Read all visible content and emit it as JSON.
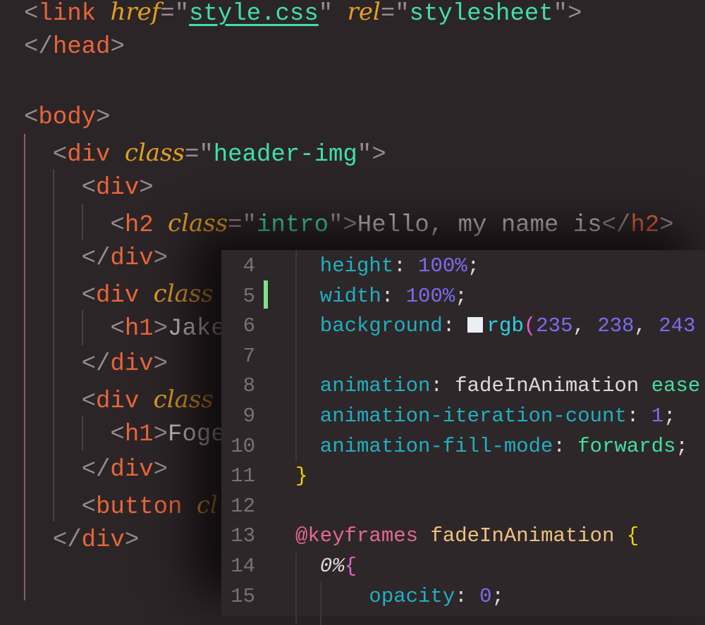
{
  "html_editor": {
    "lines": [
      [
        [
          "<",
          "br"
        ],
        [
          "link",
          "tag"
        ],
        [
          " ",
          ""
        ],
        [
          "href",
          "attr"
        ],
        [
          "=\"",
          "br"
        ],
        [
          "style.css",
          "str ul"
        ],
        [
          "\"",
          "br"
        ],
        [
          " ",
          ""
        ],
        [
          "rel",
          "attr"
        ],
        [
          "=\"",
          "br"
        ],
        [
          "stylesheet",
          "str"
        ],
        [
          "\">",
          "br"
        ]
      ],
      [
        [
          "</",
          "br"
        ],
        [
          "head",
          "tag"
        ],
        [
          ">",
          "br"
        ]
      ],
      [],
      [
        [
          "<",
          "br"
        ],
        [
          "body",
          "tag"
        ],
        [
          ">",
          "br"
        ]
      ],
      [
        [
          "  <",
          "br"
        ],
        [
          "div",
          "tag"
        ],
        [
          " ",
          ""
        ],
        [
          "class",
          "attr"
        ],
        [
          "=\"",
          "br"
        ],
        [
          "header-img",
          "str"
        ],
        [
          "\">",
          "br"
        ]
      ],
      [
        [
          "    <",
          "br"
        ],
        [
          "div",
          "tag"
        ],
        [
          ">",
          "br"
        ]
      ],
      [
        [
          "      <",
          "br"
        ],
        [
          "h2",
          "tag"
        ],
        [
          " ",
          ""
        ],
        [
          "class",
          "attr"
        ],
        [
          "=\"",
          "br"
        ],
        [
          "intro",
          "str"
        ],
        [
          "\">",
          "br"
        ],
        [
          "Hello, my name is",
          "txt"
        ],
        [
          "</",
          "br"
        ],
        [
          "h2",
          "tag"
        ],
        [
          ">",
          "br"
        ]
      ],
      [
        [
          "    </",
          "br"
        ],
        [
          "div",
          "tag"
        ],
        [
          ">",
          "br"
        ]
      ],
      [
        [
          "    <",
          "br"
        ],
        [
          "div",
          "tag"
        ],
        [
          " ",
          ""
        ],
        [
          "class",
          "attr"
        ]
      ],
      [
        [
          "      <",
          "br"
        ],
        [
          "h1",
          "tag"
        ],
        [
          ">",
          "br"
        ],
        [
          "Jake",
          "txt"
        ]
      ],
      [
        [
          "    </",
          "br"
        ],
        [
          "div",
          "tag"
        ],
        [
          ">",
          "br"
        ]
      ],
      [
        [
          "    <",
          "br"
        ],
        [
          "div",
          "tag"
        ],
        [
          " ",
          ""
        ],
        [
          "class",
          "attr"
        ]
      ],
      [
        [
          "      <",
          "br"
        ],
        [
          "h1",
          "tag"
        ],
        [
          ">",
          "br"
        ],
        [
          "Foge",
          "txt"
        ]
      ],
      [
        [
          "    </",
          "br"
        ],
        [
          "div",
          "tag"
        ],
        [
          ">",
          "br"
        ]
      ],
      [
        [
          "    <",
          "br"
        ],
        [
          "button",
          "tag"
        ],
        [
          " ",
          ""
        ],
        [
          "cl",
          "attr"
        ]
      ],
      [
        [
          "  </",
          "br"
        ],
        [
          "div",
          "tag"
        ],
        [
          ">",
          "br"
        ]
      ]
    ]
  },
  "css_editor": {
    "lines": [
      {
        "n": "4",
        "t": [
          [
            "  height",
            "prop"
          ],
          [
            ": ",
            "pl"
          ],
          [
            "100%",
            "num"
          ],
          [
            ";",
            "pl"
          ]
        ]
      },
      {
        "n": "5",
        "t": [
          [
            "  width",
            "prop"
          ],
          [
            ": ",
            "pl"
          ],
          [
            "100%",
            "num"
          ],
          [
            ";",
            "pl"
          ]
        ]
      },
      {
        "n": "6",
        "t": [
          [
            "  background",
            "prop"
          ],
          [
            ": ",
            "pl"
          ],
          [
            "#SWATCH",
            ""
          ],
          [
            "rgb",
            "fn"
          ],
          [
            "(",
            "paren"
          ],
          [
            "235",
            "num"
          ],
          [
            ", ",
            "pl"
          ],
          [
            "238",
            "num"
          ],
          [
            ", ",
            "pl"
          ],
          [
            "243",
            "num"
          ]
        ]
      },
      {
        "n": "7",
        "t": []
      },
      {
        "n": "8",
        "t": [
          [
            "  animation",
            "prop"
          ],
          [
            ": ",
            "pl"
          ],
          [
            "fadeInAnimation ",
            "pl"
          ],
          [
            "ease",
            "kw"
          ]
        ]
      },
      {
        "n": "9",
        "t": [
          [
            "  animation-iteration-count",
            "prop"
          ],
          [
            ": ",
            "pl"
          ],
          [
            "1",
            "num"
          ],
          [
            ";",
            "pl"
          ]
        ]
      },
      {
        "n": "10",
        "t": [
          [
            "  animation-fill-mode",
            "prop"
          ],
          [
            ": ",
            "pl"
          ],
          [
            "forwards",
            "kw"
          ],
          [
            ";",
            "pl"
          ]
        ]
      },
      {
        "n": "11",
        "t": [
          [
            "}",
            "brace"
          ]
        ]
      },
      {
        "n": "12",
        "t": []
      },
      {
        "n": "13",
        "t": [
          [
            "@keyframes",
            "at"
          ],
          [
            " ",
            ""
          ],
          [
            "fadeInAnimation",
            "name"
          ],
          [
            " ",
            ""
          ],
          [
            "{",
            "brace"
          ]
        ]
      },
      {
        "n": "14",
        "t": [
          [
            "  0%",
            "it"
          ],
          [
            "{",
            "paren"
          ]
        ]
      },
      {
        "n": "15",
        "t": [
          [
            "      opacity",
            "prop"
          ],
          [
            ": ",
            "pl"
          ],
          [
            "0",
            "num"
          ],
          [
            ";",
            "pl"
          ]
        ]
      }
    ],
    "swatch_color": "#ebeef3",
    "modified_line": "5"
  }
}
